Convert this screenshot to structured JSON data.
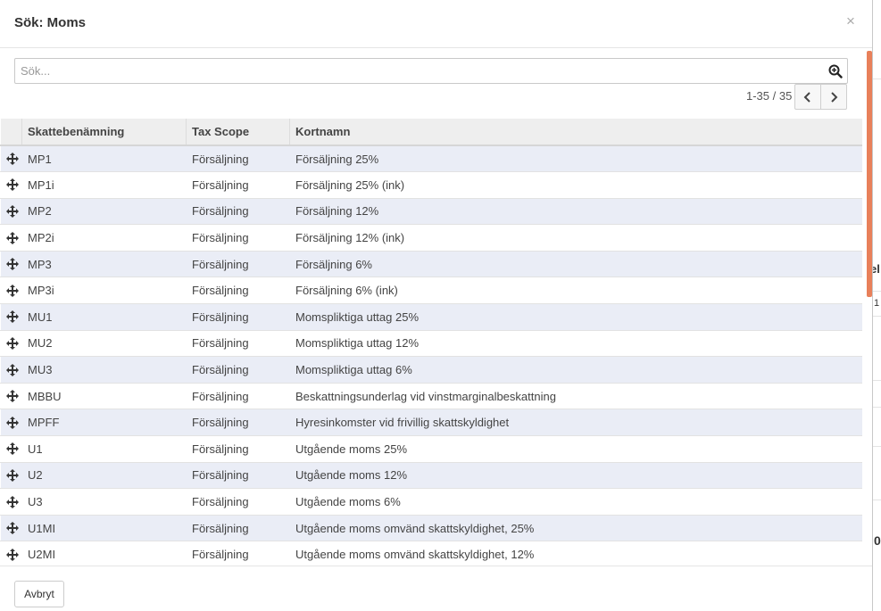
{
  "modal": {
    "title": "Sök: Moms",
    "close_label": "×"
  },
  "search": {
    "placeholder": "Sök...",
    "value": ""
  },
  "pager": {
    "value": "1-35 / 35"
  },
  "table": {
    "headers": [
      "Skattebenämning",
      "Tax Scope",
      "Kortnamn"
    ],
    "rows": [
      [
        "MP1",
        "Försäljning",
        "Försäljning 25%"
      ],
      [
        "MP1i",
        "Försäljning",
        "Försäljning 25% (ink)"
      ],
      [
        "MP2",
        "Försäljning",
        "Försäljning 12%"
      ],
      [
        "MP2i",
        "Försäljning",
        "Försäljning 12% (ink)"
      ],
      [
        "MP3",
        "Försäljning",
        "Försäljning 6%"
      ],
      [
        "MP3i",
        "Försäljning",
        "Försäljning 6% (ink)"
      ],
      [
        "MU1",
        "Försäljning",
        "Momspliktiga uttag 25%"
      ],
      [
        "MU2",
        "Försäljning",
        "Momspliktiga uttag 12%"
      ],
      [
        "MU3",
        "Försäljning",
        "Momspliktiga uttag 6%"
      ],
      [
        "MBBU",
        "Försäljning",
        "Beskattningsunderlag vid vinstmarginalbeskattning"
      ],
      [
        "MPFF",
        "Försäljning",
        "Hyresinkomster vid frivillig skattskyldighet"
      ],
      [
        "U1",
        "Försäljning",
        "Utgående moms 25%"
      ],
      [
        "U2",
        "Försäljning",
        "Utgående moms 12%"
      ],
      [
        "U3",
        "Försäljning",
        "Utgående moms 6%"
      ],
      [
        "U1MI",
        "Försäljning",
        "Utgående moms omvänd skattskyldighet, 25%"
      ],
      [
        "U2MI",
        "Försäljning",
        "Utgående moms omvänd skattskyldighet, 12%"
      ]
    ]
  },
  "footer": {
    "cancel_label": "Avbryt"
  },
  "background": {
    "glyph_a": "el",
    "glyph_b": "1",
    "glyph_c": "0"
  },
  "colors": {
    "accent_scrollbar": "#e8805a",
    "row_stripe": "#eaedf6",
    "header_bg": "#eeeeee"
  },
  "icons": {
    "search": "search-icon",
    "close": "close-icon",
    "row_handle": "move-handle-icon",
    "prev": "chevron-left-icon",
    "next": "chevron-right-icon"
  }
}
